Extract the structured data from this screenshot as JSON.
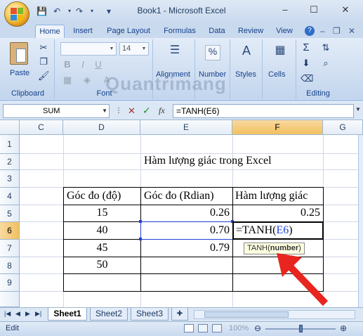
{
  "window": {
    "title": "Book1 - Microsoft Excel",
    "controls": {
      "minimize": "–",
      "maximize": "☐",
      "close": "✕"
    }
  },
  "quick_access": {
    "save": "💾",
    "undo": "↶",
    "redo": "↷",
    "more": "▾"
  },
  "ribbon": {
    "tabs": [
      "Home",
      "Insert",
      "Page Layout",
      "Formulas",
      "Data",
      "Review",
      "View"
    ],
    "active_tab": "Home",
    "help_icon": "?",
    "groups": {
      "clipboard": {
        "label": "Clipboard",
        "paste_label": "Paste"
      },
      "font": {
        "label": "Font",
        "font_size": "14",
        "bold": "B",
        "italic": "I",
        "underline": "U"
      },
      "alignment": {
        "label": "Alignment"
      },
      "number": {
        "label": "Number",
        "icon": "%"
      },
      "styles": {
        "label": "Styles"
      },
      "cells": {
        "label": "Cells"
      },
      "editing": {
        "label": "Editing",
        "sum_icon": "Σ"
      }
    }
  },
  "formula_bar": {
    "name_box": "SUM",
    "fx_label": "fx",
    "formula": "=TANH(E6)"
  },
  "grid": {
    "columns": [
      "C",
      "D",
      "E",
      "F",
      "G"
    ],
    "selected_column": "F",
    "rows": [
      "1",
      "2",
      "3",
      "4",
      "5",
      "6",
      "7",
      "8",
      "9"
    ],
    "selected_row": "6",
    "title": "Hàm lượng giác trong Excel",
    "headers": {
      "d": "Góc đo (độ)",
      "e": "Góc đo (Rdian)",
      "f": "Hàm lượng giác"
    },
    "data": [
      {
        "d": "15",
        "e": "0.26",
        "f": "0.25"
      },
      {
        "d": "40",
        "e": "0.70",
        "f_edit_prefix": "=TANH(",
        "f_edit_ref": "E6",
        "f_edit_suffix": ")"
      },
      {
        "d": "45",
        "e": "0.79",
        "f": ""
      },
      {
        "d": "50",
        "e": "",
        "f": ""
      }
    ],
    "tooltip": {
      "func": "TANH(",
      "arg": "number",
      "close": ")"
    }
  },
  "sheets": {
    "tabs": [
      "Sheet1",
      "Sheet2",
      "Sheet3"
    ],
    "active": "Sheet1"
  },
  "status": {
    "mode": "Edit",
    "zoom": "100%"
  },
  "watermark": "Quantrimang",
  "colors": {
    "ref_blue": "#1f3fd6",
    "arrow_red": "#e8251f",
    "select_orange": "#f1c15f"
  }
}
